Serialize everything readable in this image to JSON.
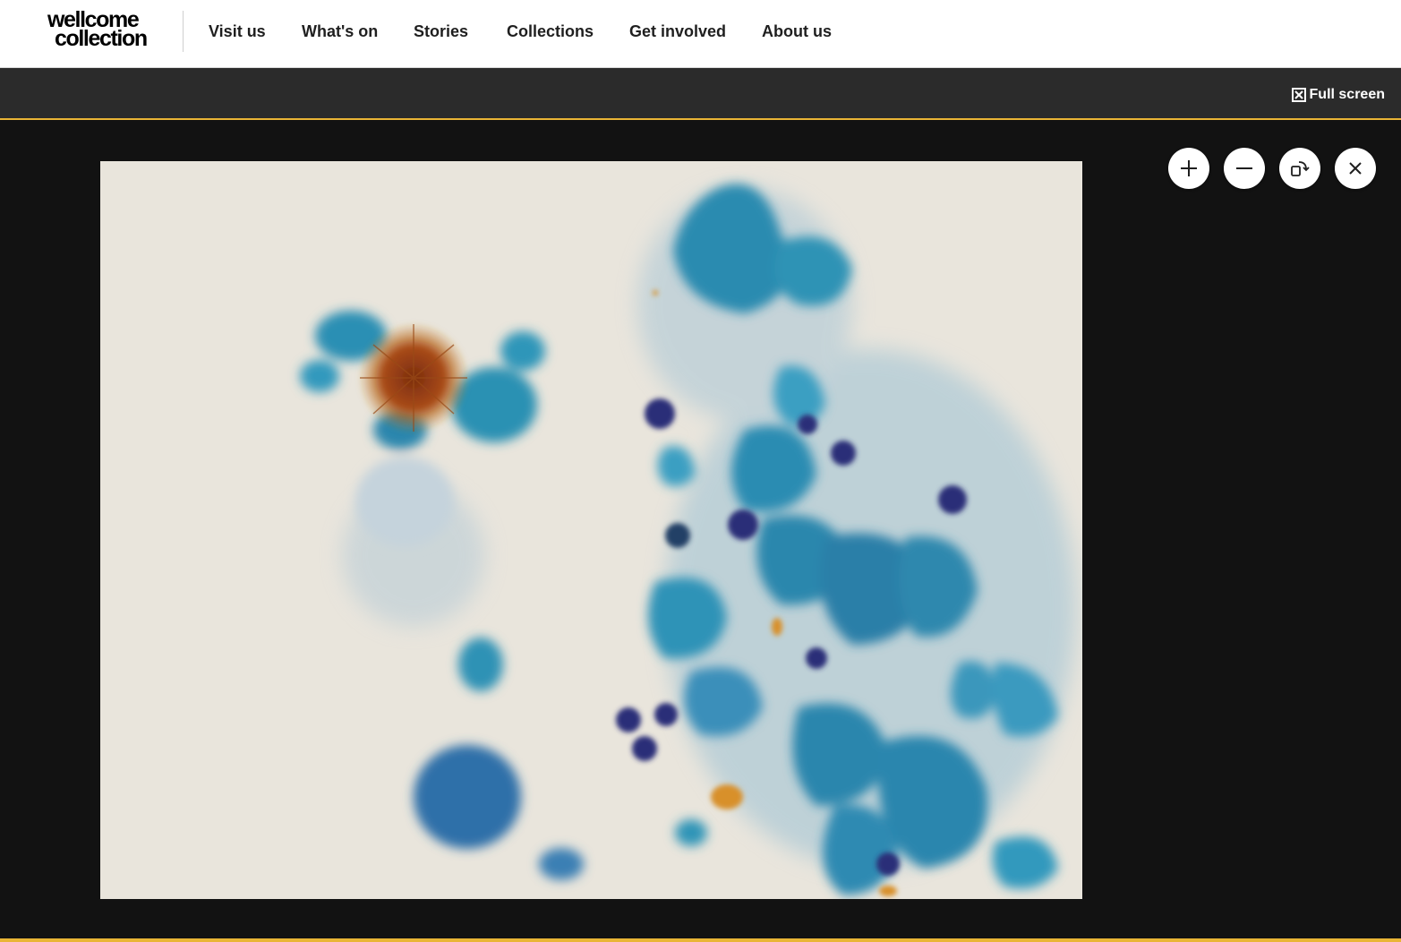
{
  "brand": {
    "logo_line1": "wellcome",
    "logo_line2": "collection"
  },
  "nav": {
    "items": [
      {
        "label": "Visit us",
        "active": false
      },
      {
        "label": "What's on",
        "active": false
      },
      {
        "label": "Stories",
        "active": false
      },
      {
        "label": "Collections",
        "active": true
      },
      {
        "label": "Get involved",
        "active": false
      },
      {
        "label": "About us",
        "active": false
      }
    ]
  },
  "viewer": {
    "fullscreen_label": "Full screen",
    "controls": [
      {
        "name": "zoom-in-button",
        "icon": "plus-icon"
      },
      {
        "name": "zoom-out-button",
        "icon": "minus-icon"
      },
      {
        "name": "rotate-button",
        "icon": "rotate-icon"
      },
      {
        "name": "close-button",
        "icon": "close-icon"
      }
    ]
  },
  "colors": {
    "accent": "#ffce3c",
    "toolbar_bg": "#2b2b2b",
    "viewer_bg": "#121212",
    "rule": "#e9b536"
  }
}
